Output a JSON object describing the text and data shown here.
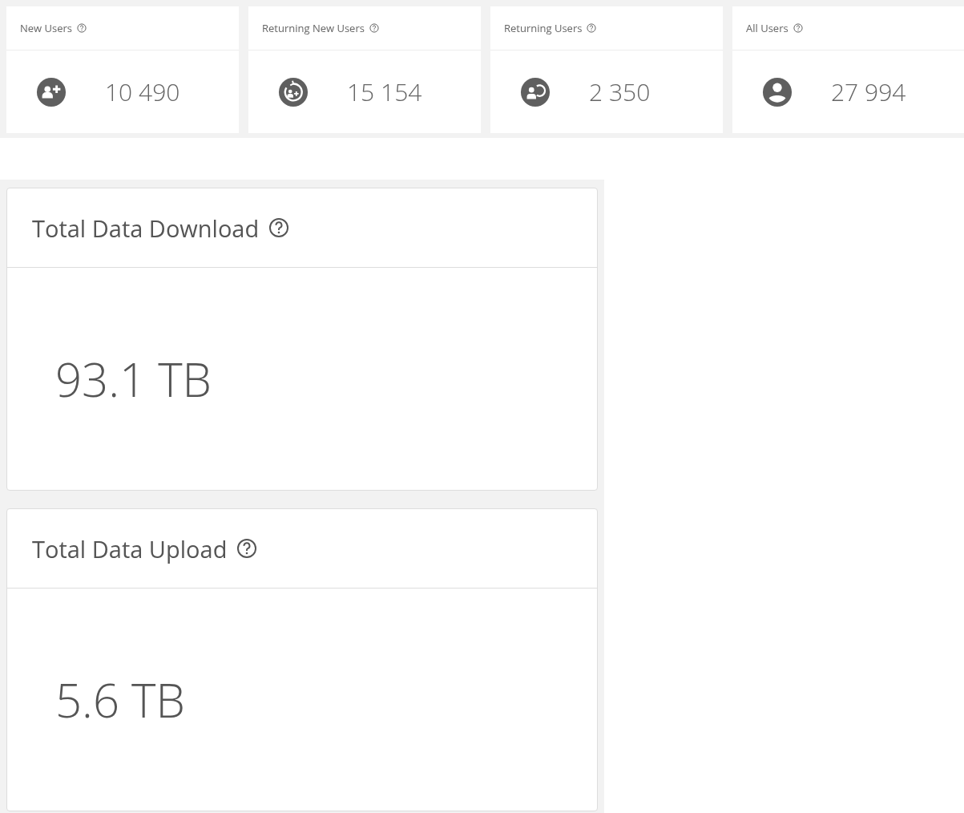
{
  "user_stats": [
    {
      "title": "New Users",
      "value": "10 490",
      "kind": "new"
    },
    {
      "title": "Returning New Users",
      "value": "15 154",
      "kind": "returning_new"
    },
    {
      "title": "Returning Users",
      "value": "2 350",
      "kind": "returning"
    },
    {
      "title": "All Users",
      "value": "27 994",
      "kind": "all"
    }
  ],
  "data_stats": [
    {
      "title": "Total Data Download",
      "value": "93.1 TB"
    },
    {
      "title": "Total Data Upload",
      "value": "5.6 TB"
    }
  ]
}
